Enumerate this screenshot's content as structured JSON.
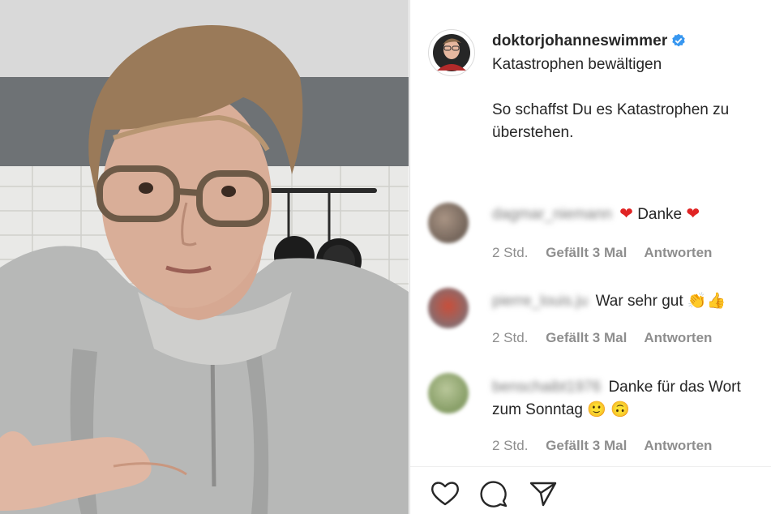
{
  "post": {
    "username": "doktorjohanneswimmer",
    "title": "Katastrophen bewältigen",
    "body": "So schaffst Du es Katastrophen zu überstehen."
  },
  "comments": [
    {
      "name": "dagmar_niemann",
      "text": "Danke",
      "time": "2 Std.",
      "likes": "Gefällt 3 Mal",
      "reply": "Antworten"
    },
    {
      "name": "pierre_louis.ju",
      "text": "War sehr gut",
      "time": "2 Std.",
      "likes": "Gefällt 3 Mal",
      "reply": "Antworten"
    },
    {
      "name": "benschaibt1976",
      "text": "Danke für das Wort zum Sonntag",
      "time": "2 Std.",
      "likes": "Gefällt 3 Mal",
      "reply": "Antworten"
    }
  ],
  "icons": [
    "verified-badge-icon",
    "heart-icon",
    "comment-icon",
    "share-icon"
  ],
  "colors": {
    "verified": "#3897f0",
    "heart_emoji": "#e02424",
    "meta_text": "#8e8e8e"
  }
}
